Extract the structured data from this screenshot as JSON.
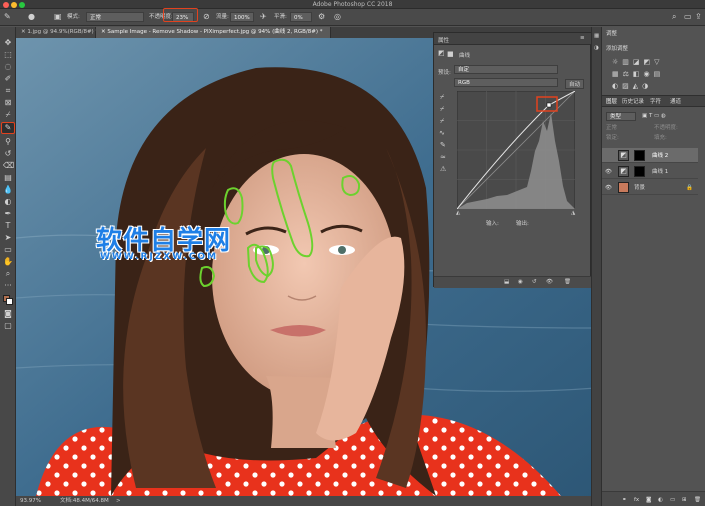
{
  "app": {
    "title": "Adobe Photoshop CC 2018"
  },
  "options": {
    "mode_label": "模式:",
    "mode_value": "正常",
    "opacity_label": "不透明度:",
    "opacity_value": "23%",
    "flow_label": "流量:",
    "flow_value": "100%",
    "smooth_label": "平滑:",
    "smooth_value": "0%"
  },
  "tabs": [
    {
      "label": "1.jpg @ 94.9%(RGB/8#) *"
    },
    {
      "label": "Sample Image - Remove Shadow - PIXimperfect.jpg @ 94% (曲线 2, RGB/8#) *"
    }
  ],
  "status": {
    "zoom": "93.97%",
    "doc": "文档:48.4M/64.8M"
  },
  "watermark": {
    "title": "软件自学网",
    "url": "WWW.RJZXW.COM",
    "title_color": "#1f7fe6"
  },
  "properties": {
    "title": "属性",
    "type_label": "曲线",
    "preset_label": "预设:",
    "preset_value": "自定",
    "channel_value": "RGB",
    "auto_label": "自动",
    "input_label": "输入:",
    "output_label": "输出:"
  },
  "adjust": {
    "tab": "调整",
    "add_label": "添加调整"
  },
  "layers_panel": {
    "tabs": [
      "图层",
      "历史记录",
      "字符",
      "通道"
    ],
    "kind_label": "类型",
    "mode": "正常",
    "opacity_label": "不透明度:",
    "fill_label": "填充:",
    "lock_label": "锁定:",
    "layers": [
      {
        "name": "曲线 2",
        "selected": true
      },
      {
        "name": "曲线 1",
        "selected": false
      },
      {
        "name": "背景",
        "selected": false
      }
    ]
  }
}
